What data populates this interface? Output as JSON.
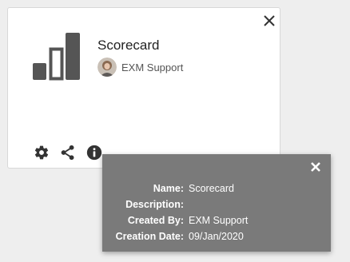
{
  "card": {
    "title": "Scorecard",
    "owner": "EXM Support",
    "icon": "bar-chart-icon",
    "actions": [
      "gear-icon",
      "share-icon",
      "info-icon"
    ]
  },
  "popup": {
    "rows": [
      {
        "label": "Name:",
        "value": "Scorecard"
      },
      {
        "label": "Description:",
        "value": ""
      },
      {
        "label": "Created By:",
        "value": "EXM Support"
      },
      {
        "label": "Creation Date:",
        "value": "09/Jan/2020"
      }
    ]
  },
  "colors": {
    "icon": "#555555",
    "popup_bg": "#7a7a7a",
    "page_bg": "#eeeeee"
  }
}
